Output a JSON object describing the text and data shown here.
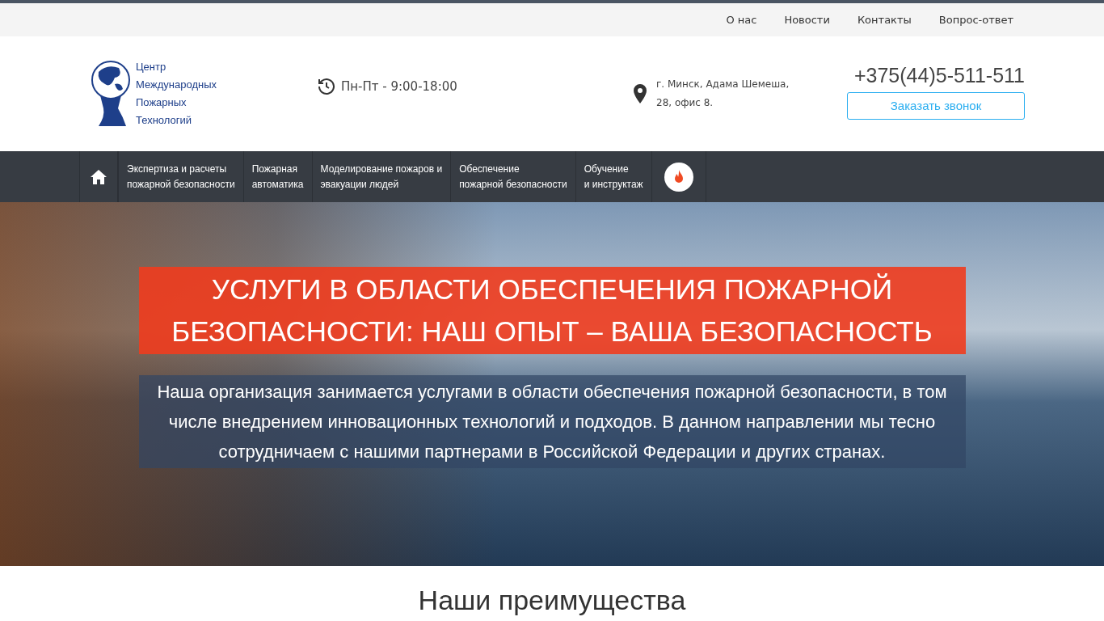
{
  "top_links": [
    "О нас",
    "Новости",
    "Контакты",
    "Вопрос-ответ"
  ],
  "logo": {
    "lines": [
      "Центр",
      "Международных",
      "Пожарных",
      "Технологий"
    ]
  },
  "hours": "Пн-Пт - 9:00-18:00",
  "address": [
    "г. Минск, Адама Шемеша,",
    "28, офис 8."
  ],
  "phone": "+375(44)5-511-511",
  "callback_button": "Заказать звонок",
  "nav": [
    {
      "kind": "home"
    },
    {
      "kind": "text",
      "lines": [
        "Экспертиза и расчеты",
        "пожарной безопасности"
      ]
    },
    {
      "kind": "text",
      "lines": [
        "Пожарная",
        "автоматика"
      ]
    },
    {
      "kind": "text",
      "lines": [
        "Моделирование пожаров и",
        "эвакуации людей"
      ]
    },
    {
      "kind": "text",
      "lines": [
        "Обеспечение",
        "пожарной безопасности"
      ]
    },
    {
      "kind": "text",
      "lines": [
        "Обучение",
        "и инструктаж"
      ]
    },
    {
      "kind": "fire"
    }
  ],
  "hero": {
    "title_lines": [
      "УСЛУГИ В ОБЛАСТИ ОБЕСПЕЧЕНИЯ ПОЖАРНОЙ",
      "БЕЗОПАСНОСТИ: НАШ ОПЫТ – ВАША БЕЗОПАСНОСТЬ"
    ],
    "text": "Наша организация занимается услугами в области обеспечения пожарной безопасности, в том числе внедрением инновационных технологий и подходов. В данном направлении мы тесно сотрудничаем с нашими партнерами в Российской Федерации и других странах."
  },
  "section_title": "Наши преимущества"
}
